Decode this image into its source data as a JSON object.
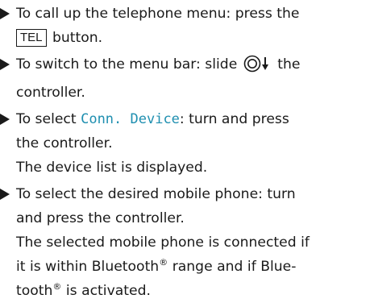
{
  "steps": [
    {
      "line1_text": "To call up the telephone menu: press the",
      "key_label": "TEL",
      "line2_text": "button."
    },
    {
      "line1_before": "To switch to the menu bar: slide",
      "line1_after": "the",
      "line2_text": "controller.",
      "icon": "controller-slide-down-icon"
    },
    {
      "line1_before": "To select",
      "display_text": "Conn. Device",
      "line1_after": ": turn and press",
      "line2_text": "the controller.",
      "result_text": "The device list is displayed."
    },
    {
      "line1_text": "To select the desired mobile phone: turn",
      "line2_text": "and press the controller.",
      "result_line1": "The selected mobile phone is connected if",
      "result_line2_before": "it is within Bluetooth",
      "result_line2_after": "range and if Blue-",
      "result_line3_before": "tooth",
      "result_line3_after": "is activated.",
      "registered_mark": "®"
    }
  ],
  "colors": {
    "text": "#1a1a1a",
    "display_text": "#1f8fb0"
  }
}
